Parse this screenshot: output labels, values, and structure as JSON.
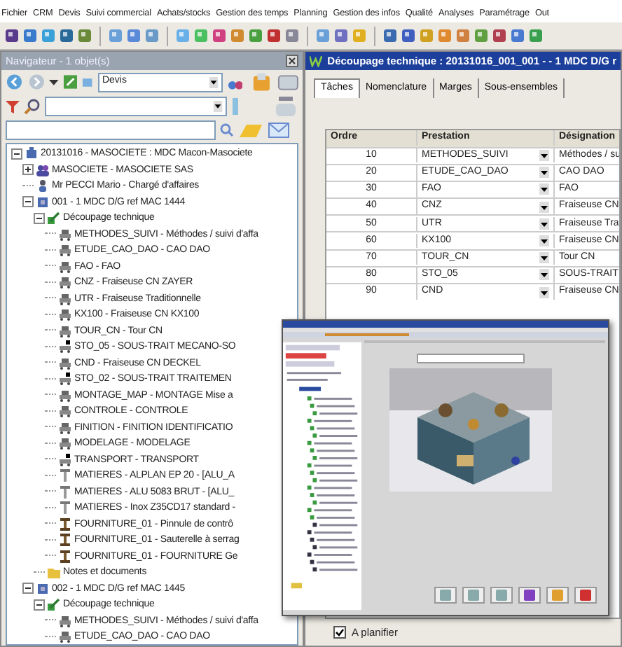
{
  "menu": [
    "Fichier",
    "CRM",
    "Devis",
    "Suivi commercial",
    "Achats/stocks",
    "Gestion des temps",
    "Planning",
    "Gestion des infos",
    "Qualité",
    "Analyses",
    "Paramétrage",
    "Out"
  ],
  "navigator": {
    "title": "Navigateur - 1 objet(s)",
    "filter": {
      "value": "Devis"
    },
    "tree": [
      {
        "label": "20131016 - MASOCIETE : MDC Macon-Masociete",
        "kind": "project",
        "expanded": true,
        "children": [
          {
            "label": "MASOCIETE - MASOCIETE SAS",
            "kind": "client",
            "expanded": false
          },
          {
            "label": "Mr PECCI Mario - Chargé d'affaires",
            "kind": "contact"
          },
          {
            "label": "001 - 1 MDC D/G ref MAC 1444",
            "kind": "item",
            "expanded": true,
            "children": [
              {
                "label": "Découpage technique",
                "kind": "cutting",
                "expanded": true,
                "children": [
                  {
                    "label": "METHODES_SUIVI - Méthodes / suivi d'affa",
                    "kind": "task"
                  },
                  {
                    "label": "ETUDE_CAO_DAO - CAO DAO",
                    "kind": "task"
                  },
                  {
                    "label": "FAO - FAO",
                    "kind": "task"
                  },
                  {
                    "label": "CNZ - Fraiseuse CN ZAYER",
                    "kind": "task"
                  },
                  {
                    "label": "UTR - Fraiseuse Traditionnelle",
                    "kind": "task"
                  },
                  {
                    "label": "KX100 - Fraiseuse CN KX100",
                    "kind": "task"
                  },
                  {
                    "label": "TOUR_CN - Tour CN",
                    "kind": "task"
                  },
                  {
                    "label": "STO_05 - SOUS-TRAIT MECANO-SO",
                    "kind": "subcontract"
                  },
                  {
                    "label": "CND - Fraiseuse CN DECKEL",
                    "kind": "task"
                  },
                  {
                    "label": "STO_02 - SOUS-TRAIT TRAITEMEN",
                    "kind": "subcontract"
                  },
                  {
                    "label": "MONTAGE_MAP - MONTAGE Mise a",
                    "kind": "task"
                  },
                  {
                    "label": "CONTROLE - CONTROLE",
                    "kind": "task"
                  },
                  {
                    "label": "FINITION - FINITION IDENTIFICATIO",
                    "kind": "task"
                  },
                  {
                    "label": "MODELAGE - MODELAGE",
                    "kind": "task"
                  },
                  {
                    "label": "TRANSPORT - TRANSPORT",
                    "kind": "subcontract"
                  },
                  {
                    "label": "MATIERES - ALPLAN EP 20 - [ALU_A",
                    "kind": "material"
                  },
                  {
                    "label": "MATIERES - ALU 5083 BRUT - [ALU_",
                    "kind": "material"
                  },
                  {
                    "label": "MATIERES - Inox Z35CD17 standard -",
                    "kind": "material"
                  },
                  {
                    "label": "FOURNITURE_01 - Pinnule de contrô",
                    "kind": "supply"
                  },
                  {
                    "label": "FOURNITURE_01 - Sauterelle à serrag",
                    "kind": "supply"
                  },
                  {
                    "label": "FOURNITURE_01 - FOURNITURE Ge",
                    "kind": "supply"
                  }
                ]
              },
              {
                "label": "Notes et documents",
                "kind": "folder"
              }
            ]
          },
          {
            "label": "002 - 1 MDC D/G ref MAC 1445",
            "kind": "item",
            "expanded": true,
            "children": [
              {
                "label": "Découpage technique",
                "kind": "cutting",
                "expanded": true,
                "children": [
                  {
                    "label": "METHODES_SUIVI - Méthodes / suivi d'affa",
                    "kind": "task"
                  },
                  {
                    "label": "ETUDE_CAO_DAO - CAO DAO",
                    "kind": "task"
                  }
                ]
              }
            ]
          }
        ]
      }
    ]
  },
  "detail": {
    "title": "Découpage technique : 20131016_001_001 - - 1 MDC D/G r",
    "tabs": [
      {
        "label": "Tâches",
        "selected": true
      },
      {
        "label": "Nomenclature",
        "selected": false
      },
      {
        "label": "Marges",
        "selected": false
      },
      {
        "label": "Sous-ensembles",
        "selected": false
      }
    ],
    "table": {
      "columns": [
        "Ordre",
        "Prestation",
        "Désignation"
      ],
      "rows": [
        {
          "ordre": "10",
          "prestation": "METHODES_SUIVI",
          "designation": "Méthodes / su"
        },
        {
          "ordre": "20",
          "prestation": "ETUDE_CAO_DAO",
          "designation": "CAO DAO"
        },
        {
          "ordre": "30",
          "prestation": "FAO",
          "designation": "FAO"
        },
        {
          "ordre": "40",
          "prestation": "CNZ",
          "designation": "Fraiseuse CN"
        },
        {
          "ordre": "50",
          "prestation": "UTR",
          "designation": "Fraiseuse Tra"
        },
        {
          "ordre": "60",
          "prestation": "KX100",
          "designation": "Fraiseuse CN"
        },
        {
          "ordre": "70",
          "prestation": "TOUR_CN",
          "designation": "Tour CN"
        },
        {
          "ordre": "80",
          "prestation": "STO_05",
          "designation": "SOUS-TRAIT"
        },
        {
          "ordre": "90",
          "prestation": "CND",
          "designation": "Fraiseuse CN"
        }
      ]
    },
    "plan_checkbox": {
      "label": "A planifier",
      "checked": true
    }
  }
}
